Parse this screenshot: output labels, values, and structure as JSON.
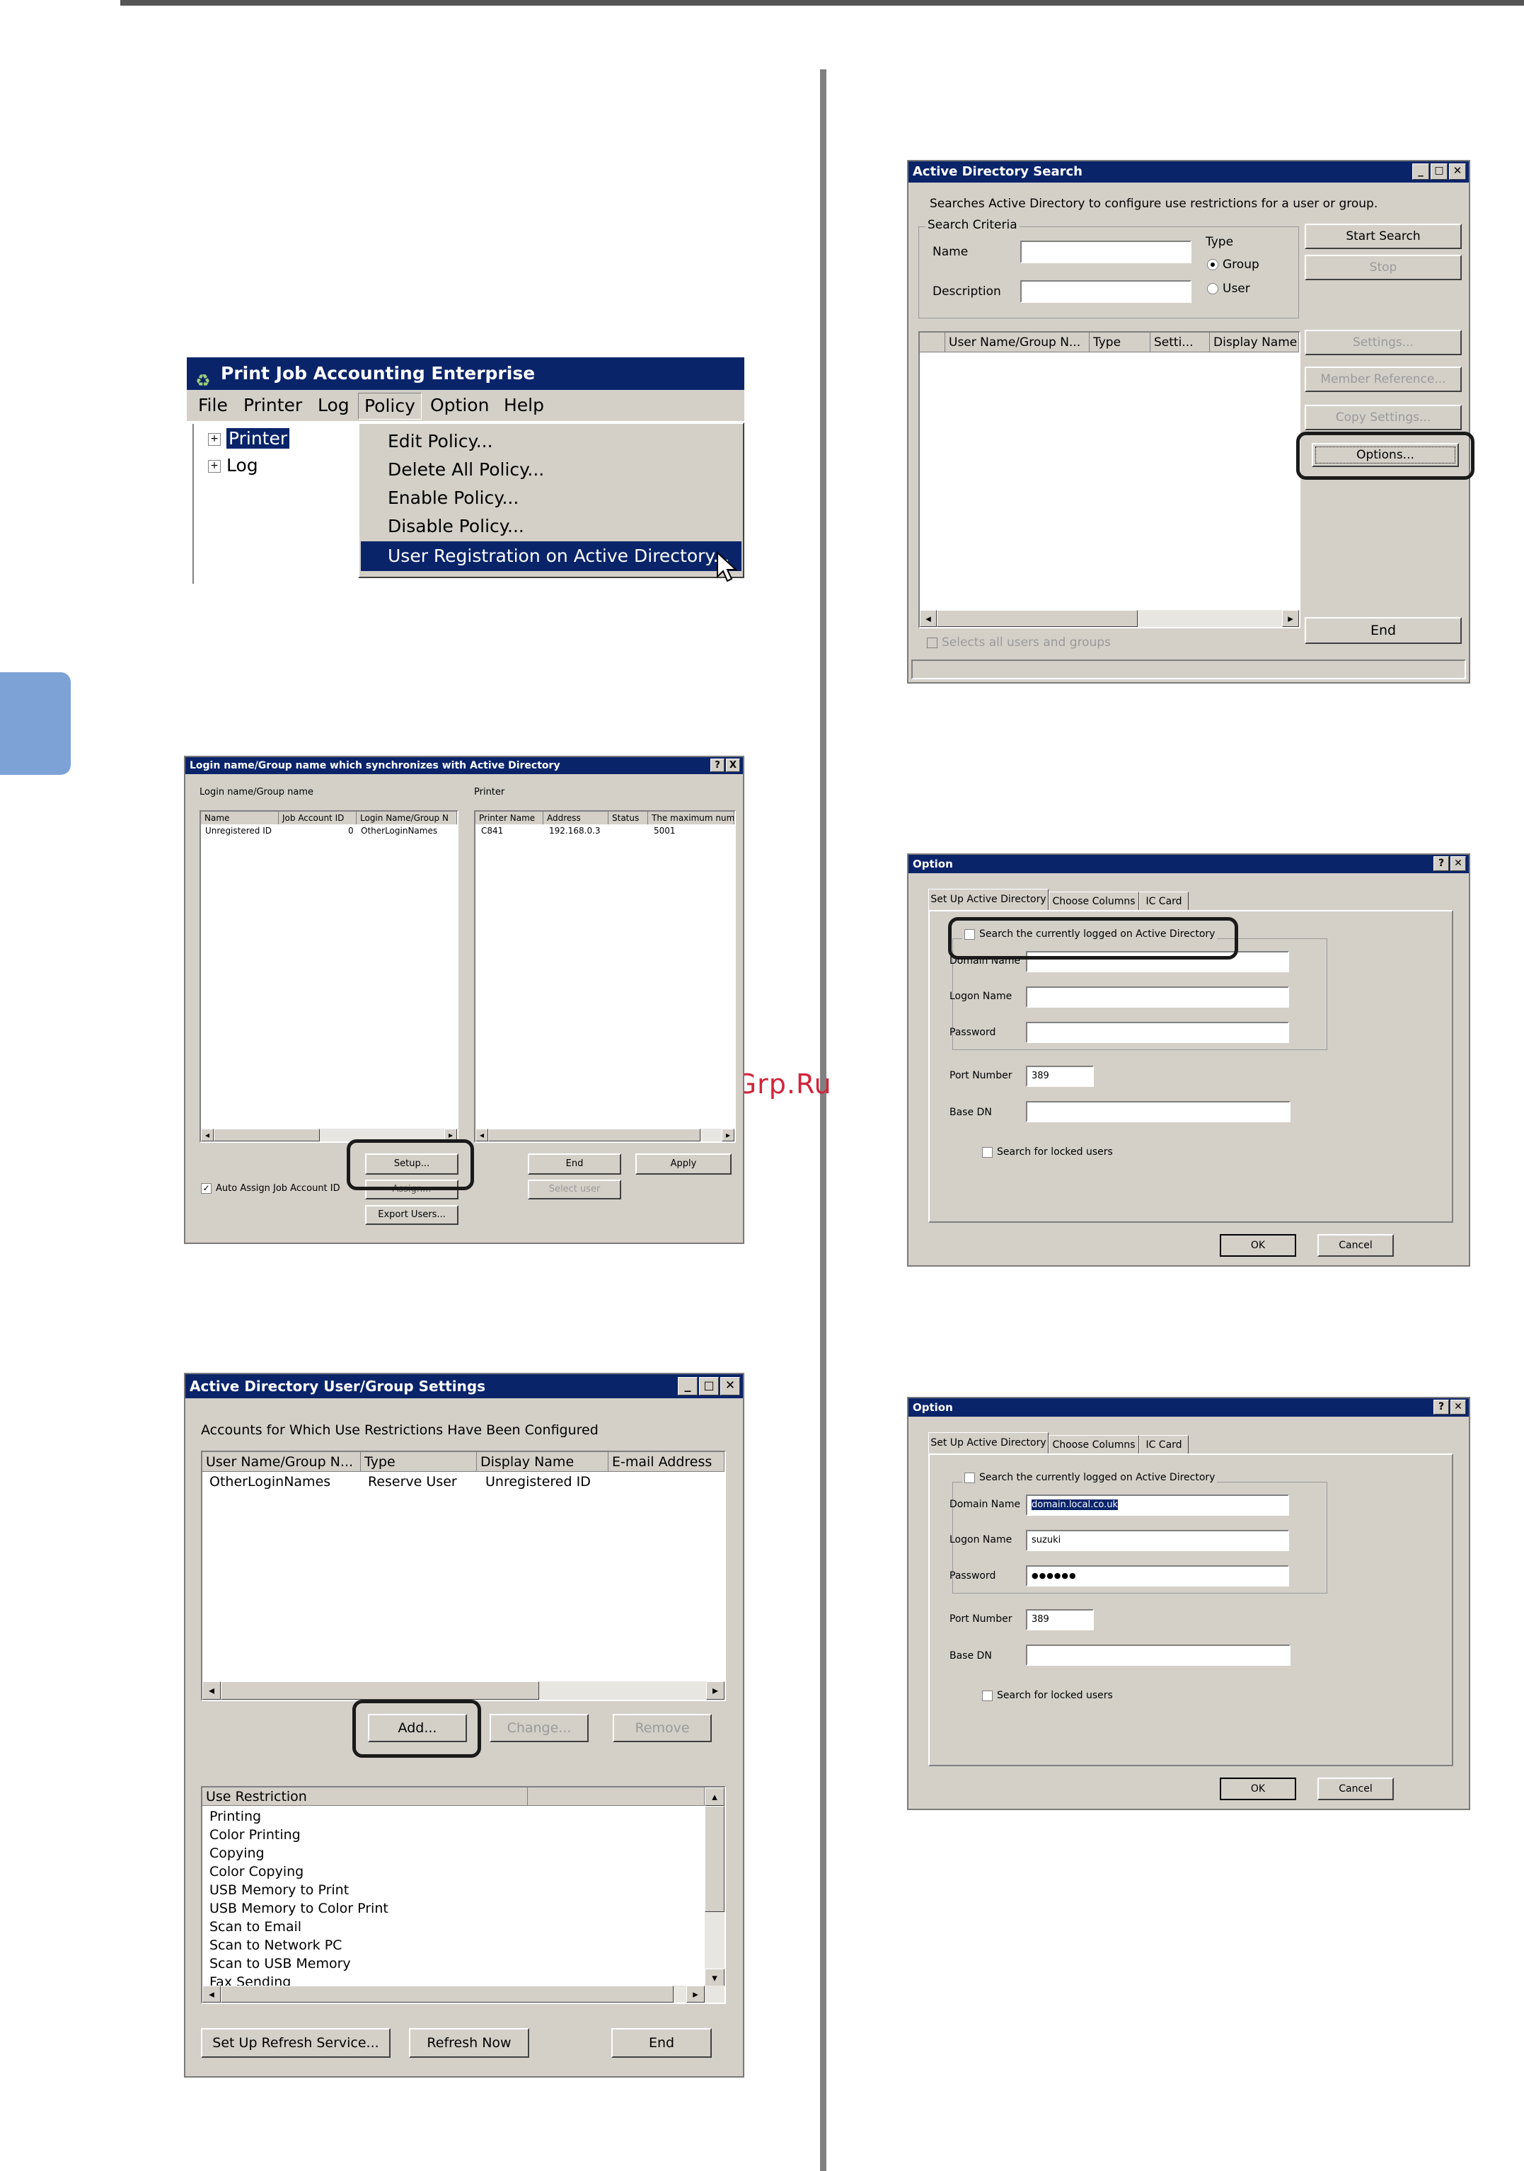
{
  "watermark": "McGrp.Ru",
  "w1": {
    "title": "Print Job Accounting Enterprise",
    "menu": [
      "File",
      "Printer",
      "Log",
      "Policy",
      "Option",
      "Help"
    ],
    "tree": [
      "Printer",
      "Log"
    ],
    "dropdown": [
      "Edit Policy...",
      "Delete All Policy...",
      "Enable Policy...",
      "Disable Policy...",
      "User Registration on Active Directory..."
    ]
  },
  "w2": {
    "title": "Login name/Group name which synchronizes with Active Directory",
    "help_btn": "?",
    "close_btn": "X",
    "left_label": "Login name/Group name",
    "left_headers": [
      "Name",
      "Job Account ID",
      "Login Name/Group N"
    ],
    "left_row": [
      "Unregistered ID",
      "0",
      "OtherLoginNames"
    ],
    "right_label": "Printer",
    "right_headers": [
      "Printer Name",
      "Address",
      "Status",
      "The maximum num"
    ],
    "right_row": [
      "C841",
      "192.168.0.3",
      "",
      "5001"
    ],
    "auto_assign": "Auto Assign Job Account ID",
    "setup_btn": "Setup...",
    "assign_btn": "Assign...",
    "export_btn": "Export Users...",
    "end_btn": "End",
    "apply_btn": "Apply",
    "select_user_btn": "Select user"
  },
  "w3": {
    "title": "Active Directory User/Group Settings",
    "desc": "Accounts for Which Use Restrictions Have Been Configured",
    "headers": [
      "User Name/Group N...",
      "Type",
      "Display Name",
      "E-mail Address"
    ],
    "row": [
      "OtherLoginNames",
      "Reserve User",
      "Unregistered ID",
      ""
    ],
    "add_btn": "Add...",
    "change_btn": "Change...",
    "remove_btn": "Remove",
    "restriction_header": "Use Restriction",
    "restrictions": [
      "Printing",
      "Color Printing",
      "Copying",
      "Color Copying",
      "USB Memory to Print",
      "USB Memory to Color Print",
      "Scan to Email",
      "Scan to Network PC",
      "Scan to USB Memory",
      "Fax Sending"
    ],
    "refresh_service_btn": "Set Up Refresh Service...",
    "refresh_now_btn": "Refresh Now",
    "end_btn": "End"
  },
  "w4": {
    "title": "Active Directory Search",
    "desc": "Searches Active Directory to configure use restrictions for a user or group.",
    "criteria_label": "Search Criteria",
    "name_label": "Name",
    "description_label": "Description",
    "type_label": "Type",
    "group_label": "Group",
    "user_label": "User",
    "headers": [
      "User Name/Group N...",
      "Type",
      "Setti...",
      "Display Name"
    ],
    "start_search_btn": "Start Search",
    "stop_btn": "Stop",
    "settings_btn": "Settings...",
    "member_ref_btn": "Member Reference...",
    "copy_settings_btn": "Copy Settings...",
    "options_btn": "Options...",
    "select_all": "Selects all users and groups",
    "end_btn": "End"
  },
  "w5": {
    "title": "Option",
    "tabs": [
      "Set Up Active Directory",
      "Choose Columns",
      "IC Card"
    ],
    "search_logged": "Search the currently logged on Active Directory",
    "domain_label": "Domain Name",
    "logon_label": "Logon Name",
    "password_label": "Password",
    "port_label": "Port Number",
    "port_value": "389",
    "basedn_label": "Base DN",
    "locked": "Search for locked users",
    "ok_btn": "OK",
    "cancel_btn": "Cancel"
  },
  "w6": {
    "title": "Option",
    "tabs": [
      "Set Up Active Directory",
      "Choose Columns",
      "IC Card"
    ],
    "search_logged": "Search the currently logged on Active Directory",
    "domain_label": "Domain Name",
    "domain_value": "domain.local.co.uk",
    "logon_label": "Logon Name",
    "logon_value": "suzuki",
    "password_label": "Password",
    "password_value": "●●●●●●",
    "port_label": "Port Number",
    "port_value": "389",
    "basedn_label": "Base DN",
    "locked": "Search for locked users",
    "ok_btn": "OK",
    "cancel_btn": "Cancel"
  }
}
